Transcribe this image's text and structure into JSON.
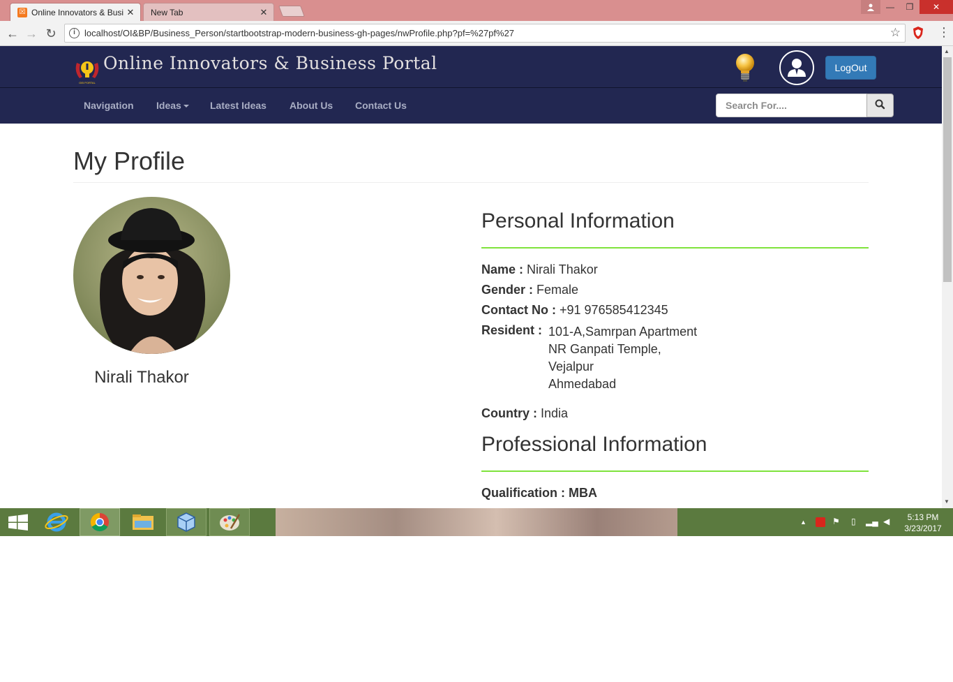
{
  "browser": {
    "tabs": [
      {
        "title": "Online Innovators & Busi",
        "active": true,
        "close": "✕"
      },
      {
        "title": "New Tab",
        "active": false,
        "close": "✕"
      }
    ],
    "url": "localhost/OI&BP/Business_Person/startbootstrap-modern-business-gh-pages/nwProfile.php?pf=%27pf%27"
  },
  "site": {
    "brand": "Online Innovators & Business Portal",
    "logo_caption": "OIB PORTAL",
    "logout_label": "LogOut",
    "nav": {
      "items": [
        "Navigation",
        "Ideas",
        "Latest Ideas",
        "About Us",
        "Contact Us"
      ]
    },
    "search": {
      "placeholder": "Search For...."
    }
  },
  "page": {
    "title": "My Profile",
    "profile_name": "Nirali Thakor",
    "personal": {
      "heading": "Personal Information",
      "name_label": "Name :",
      "name_value": "Nirali Thakor",
      "gender_label": "Gender :",
      "gender_value": "Female",
      "contact_label": "Contact No :",
      "contact_value": "+91 976585412345",
      "resident_label": "Resident :",
      "resident_lines": [
        "101-A,Samrpan Apartment",
        "NR Ganpati Temple,",
        "Vejalpur",
        "Ahmedabad"
      ],
      "country_label": "Country :",
      "country_value": "India"
    },
    "professional": {
      "heading": "Professional Information",
      "qualification_label": "Qualification :",
      "qualification_value": "MBA"
    }
  },
  "taskbar": {
    "clock_time": "5:13 PM",
    "clock_date": "3/23/2017"
  },
  "colors": {
    "header_bg": "#222751",
    "accent_green": "#7fe33c",
    "logout_blue": "#337ab7",
    "taskbar_green": "#5b7a3f",
    "tabstrip": "#d98f8f"
  },
  "icons": [
    "windows-start-icon",
    "internet-explorer-icon",
    "chrome-icon",
    "file-explorer-icon",
    "cube-app-icon",
    "paint-icon",
    "search-icon",
    "user-icon",
    "bulb-icon",
    "star-icon",
    "shield-icon"
  ]
}
